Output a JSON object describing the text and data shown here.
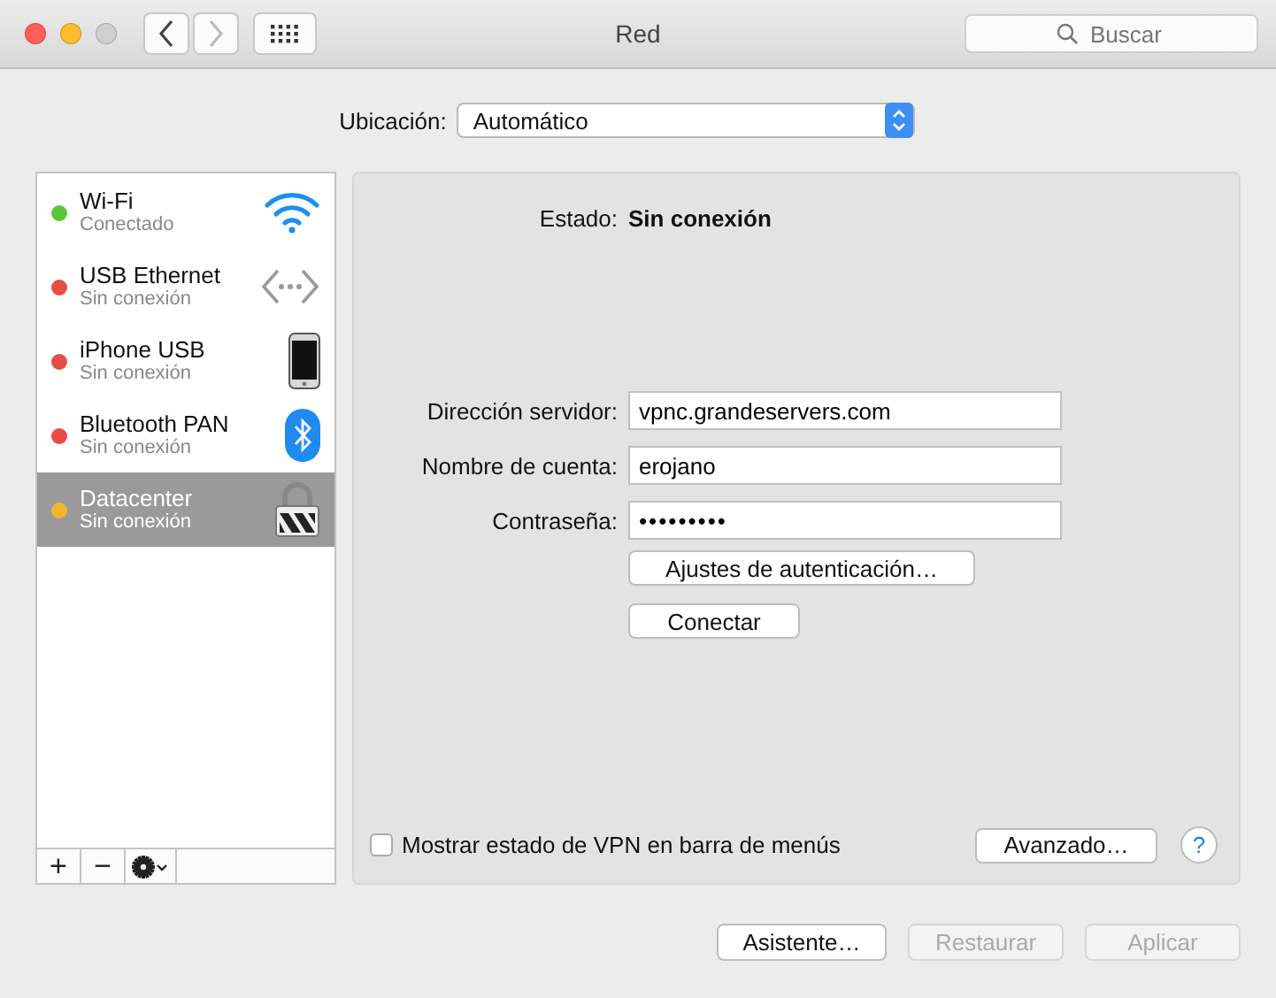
{
  "window": {
    "title": "Red",
    "search": {
      "placeholder": "Buscar"
    }
  },
  "location": {
    "label": "Ubicación:",
    "value": "Automático"
  },
  "services": [
    {
      "name": "Wi-Fi",
      "status": "Conectado",
      "color": "#5ac43a",
      "selected": false,
      "kind": "wifi"
    },
    {
      "name": "USB Ethernet",
      "status": "Sin conexión",
      "color": "#e94b45",
      "selected": false,
      "kind": "ethernet"
    },
    {
      "name": "iPhone USB",
      "status": "Sin conexión",
      "color": "#e94b45",
      "selected": false,
      "kind": "phone"
    },
    {
      "name": "Bluetooth PAN",
      "status": "Sin conexión",
      "color": "#e94b45",
      "selected": false,
      "kind": "bluetooth"
    },
    {
      "name": "Datacenter",
      "status": "Sin conexión",
      "color": "#f4b52e",
      "selected": true,
      "kind": "vpn"
    }
  ],
  "sidebar_toolbar": {
    "add": "+",
    "remove": "−"
  },
  "detail": {
    "status_label": "Estado:",
    "status_value": "Sin conexión",
    "fields": [
      {
        "label": "Dirección servidor:",
        "value": "vpnc.grandeservers.com"
      },
      {
        "label": "Nombre de cuenta:",
        "value": "erojano"
      },
      {
        "label": "Contraseña:",
        "value": "•••••••••"
      }
    ],
    "auth_button": "Ajustes de autenticación…",
    "connect_button": "Conectar",
    "show_vpn": {
      "label": "Mostrar estado de VPN en barra de menús",
      "checked": false
    },
    "advanced_button": "Avanzado…",
    "help": "?"
  },
  "footer": [
    {
      "label": "Asistente…",
      "disabled": false
    },
    {
      "label": "Restaurar",
      "disabled": true
    },
    {
      "label": "Aplicar",
      "disabled": true
    }
  ]
}
